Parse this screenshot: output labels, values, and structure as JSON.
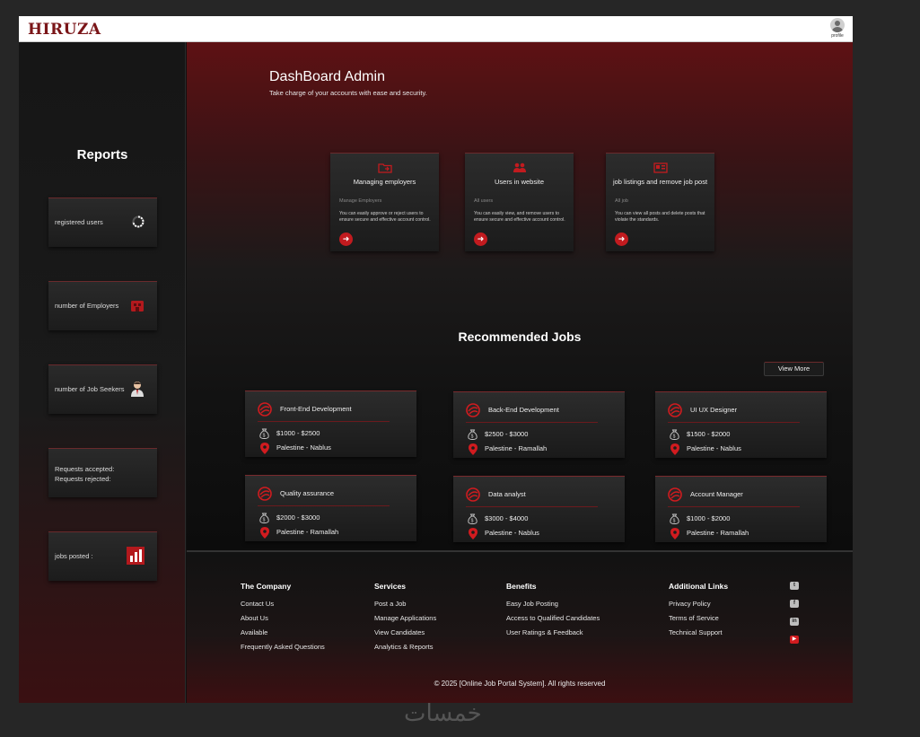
{
  "header": {
    "logo": "HIRUZA",
    "profile_label": "profile"
  },
  "sidebar": {
    "title": "Reports",
    "cards": [
      {
        "label": "registered users",
        "icon": "loading-spinner-icon"
      },
      {
        "label": "number of Employers",
        "icon": "building-icon"
      },
      {
        "label": "number of Job Seekers",
        "icon": "employee-avatar-icon"
      },
      {
        "line1": "Requests accepted:",
        "line2": "Requests rejected:"
      },
      {
        "label": "jobs posted :",
        "icon": "bar-chart-icon"
      }
    ]
  },
  "main": {
    "title": "DashBoard Admin",
    "subtitle": "Take charge of your accounts with ease and security.",
    "admin_cards": [
      {
        "title": "Managing employers",
        "link": "Manage Employers",
        "desc": "You can easily approve or reject users to ensure secure and effective account control.",
        "icon": "folder-icon"
      },
      {
        "title": "Users in website",
        "link": "All users",
        "desc": "You can easily view, and remove users to ensure secure and effective account control.",
        "icon": "users-icon"
      },
      {
        "title": "job listings and remove job post",
        "link": "All job",
        "desc": "You can view all posts and delete posts that violate the standards.",
        "icon": "job-board-icon"
      }
    ],
    "recommended_title": "Recommended Jobs",
    "view_more": "View More",
    "jobs": [
      {
        "title": "Front-End Development",
        "salary": "$1000 - $2500",
        "location": "Palestine - Nablus"
      },
      {
        "title": "Back-End Development",
        "salary": "$2500 - $3000",
        "location": "Palestine - Ramallah"
      },
      {
        "title": "UI UX Designer",
        "salary": "$1500 - $2000",
        "location": "Palestine - Nablus"
      },
      {
        "title": "Quality assurance",
        "salary": "$2000 - $3000",
        "location": "Palestine - Ramallah"
      },
      {
        "title": "Data analyst",
        "salary": "$3000 - $4000",
        "location": "Palestine - Nablus"
      },
      {
        "title": "Account Manager",
        "salary": "$1000 - $2000",
        "location": "Palestine - Ramallah"
      }
    ]
  },
  "footer": {
    "columns": [
      {
        "title": "The Company",
        "links": [
          "Contact Us",
          "About Us",
          "Available",
          "Frequently Asked Questions"
        ]
      },
      {
        "title": "Services",
        "links": [
          "Post a Job",
          "Manage Applications",
          "View Candidates",
          "Analytics & Reports"
        ]
      },
      {
        "title": "Benefits",
        "links": [
          "Easy Job Posting",
          "Access to Qualified Candidates",
          "User Ratings & Feedback"
        ]
      },
      {
        "title": "Additional Links",
        "links": [
          "Privacy Policy",
          "Terms of Service",
          "Technical Support"
        ]
      }
    ],
    "social": [
      "twitter-icon",
      "facebook-icon",
      "linkedin-icon",
      "youtube-icon"
    ],
    "copyright": "© 2025 [Online Job Portal System]. All rights reserved"
  },
  "watermark": "خمسات",
  "colors": {
    "accent": "#c21b1f",
    "brand": "#7a1518"
  }
}
